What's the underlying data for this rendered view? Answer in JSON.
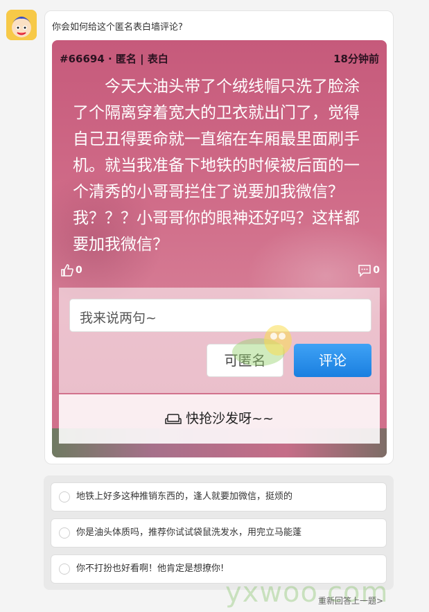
{
  "question": "你会如何给这个匿名表白墙评论?",
  "post": {
    "id_label": "#66694 · 匿名 | 表白",
    "time": "18分钟前",
    "content": "今天大油头带了个绒线帽只洗了脸涂了个隔离穿着宽大的卫衣就出门了，觉得自己丑得要命就一直缩在车厢最里面刷手机。就当我准备下地铁的时候被后面的一个清秀的小哥哥拦住了说要加我微信？我？？？小哥哥你的眼神还好吗？这样都要加我微信？",
    "likes": "0",
    "comments": "0"
  },
  "form": {
    "placeholder": "我来说两句~",
    "anon_label": "可匿名",
    "comment_label": "评论",
    "sofa_label": "快抢沙发呀~~"
  },
  "options": [
    {
      "text": "地铁上好多这种推销东西的，逢人就要加微信，挺烦的"
    },
    {
      "text": "你是油头体质吗，推荐你试试袋鼠洗发水，用完立马能蓬"
    },
    {
      "text": "你不打扮也好看啊！他肯定是想撩你!"
    }
  ],
  "redo_label": "重新回答上一题>",
  "watermark": "yxwoo.com",
  "colors": {
    "accent": "#1a7fe0",
    "card": "#cf6a87"
  }
}
